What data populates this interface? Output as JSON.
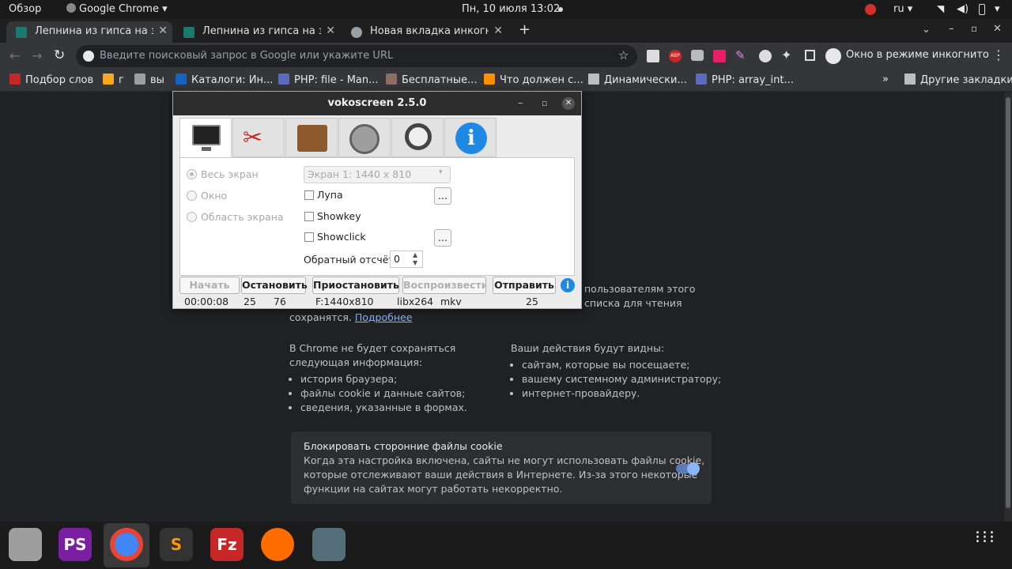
{
  "system": {
    "activities": "Обзор",
    "app_name": "Google Chrome",
    "datetime": "Пн, 10 июля  13:02",
    "language": "ru"
  },
  "tabs": [
    {
      "title": "Лепнина из гипса на заказ",
      "active": true
    },
    {
      "title": "Лепнина из гипса на заказ",
      "active": false
    },
    {
      "title": "Новая вкладка инкогнито",
      "active": false
    }
  ],
  "omnibox": {
    "placeholder": "Введите поисковый запрос в Google или укажите URL"
  },
  "incognito_label": "Окно в режиме инкогнито",
  "bookmarks": [
    {
      "label": "Подбор слов",
      "color": "#c62828"
    },
    {
      "label": "г",
      "color": "#f9a825"
    },
    {
      "label": "вы",
      "color": "#9e9e9e"
    },
    {
      "label": "Каталоги: Ин...",
      "color": "#1565c0"
    },
    {
      "label": "PHP: file - Man...",
      "color": "#5c6bc0"
    },
    {
      "label": "Бесплатные...",
      "color": "#8d6e63"
    },
    {
      "label": "Что должен с...",
      "color": "#ff8f00"
    },
    {
      "label": "Динамически...",
      "color": "#3a3a3a"
    },
    {
      "label": "PHP: array_int...",
      "color": "#5c6bc0"
    }
  ],
  "bookmarks_other": "Другие закладки",
  "incognito_page": {
    "right_top_1": "пользователям этого",
    "right_top_2": "списка для чтения",
    "saved_prefix": "сохранятся.",
    "more_link": "Подробнее",
    "left_heading_1": "В Chrome не будет сохраняться",
    "left_heading_2": "следующая информация:",
    "left_items": [
      "история браузера;",
      "файлы cookie и данные сайтов;",
      "сведения, указанные в формах."
    ],
    "right_heading": "Ваши действия будут видны:",
    "right_items": [
      "сайтам, которые вы посещаете;",
      "вашему системному администратору;",
      "интернет-провайдеру."
    ],
    "cookie_title": "Блокировать сторонние файлы cookie",
    "cookie_line1": "Когда эта настройка включена, сайты не могут использовать файлы cookie,",
    "cookie_line2": "которые отслеживают ваши действия в Интернете. Из-за этого некоторые",
    "cookie_line3": "функции на сайтах могут работать некорректно.",
    "cookie_toggle_on": true
  },
  "vokoscreen": {
    "title": "vokoscreen 2.5.0",
    "mode_fullscreen": "Весь экран",
    "mode_window": "Окно",
    "mode_area": "Область экрана",
    "screen_select": "Экран 1:  1440 x 810",
    "opt_magnifier": "Лупа",
    "opt_showkey": "Showkey",
    "opt_showclick": "Showclick",
    "countdown_label": "Обратный отсчёт",
    "countdown_value": "0",
    "dots": "...",
    "btn_start": "Начать",
    "btn_stop": "Остановить",
    "btn_pause": "Приостановить",
    "btn_play": "Воспроизвести",
    "btn_send": "Отправить",
    "info_icon": "i",
    "status_time": "00:00:08",
    "status_fps": "25",
    "status_frames": "76",
    "status_format": "F:1440x810",
    "status_codec": "libx264",
    "status_container": "mkv",
    "status_fps2": "25"
  },
  "dock": [
    {
      "name": "files",
      "label": "",
      "color": "#9e9e9e"
    },
    {
      "name": "phpstorm",
      "label": "PS",
      "color": "#7b1fa2"
    },
    {
      "name": "chrome",
      "label": "",
      "color": "#4285f4"
    },
    {
      "name": "sublime",
      "label": "S",
      "color": "#ff9800"
    },
    {
      "name": "filezilla",
      "label": "Fz",
      "color": "#c62828"
    },
    {
      "name": "firefox",
      "label": "",
      "color": "#ff6d00"
    },
    {
      "name": "vokoscreen",
      "label": "",
      "color": "#546e7a"
    }
  ]
}
